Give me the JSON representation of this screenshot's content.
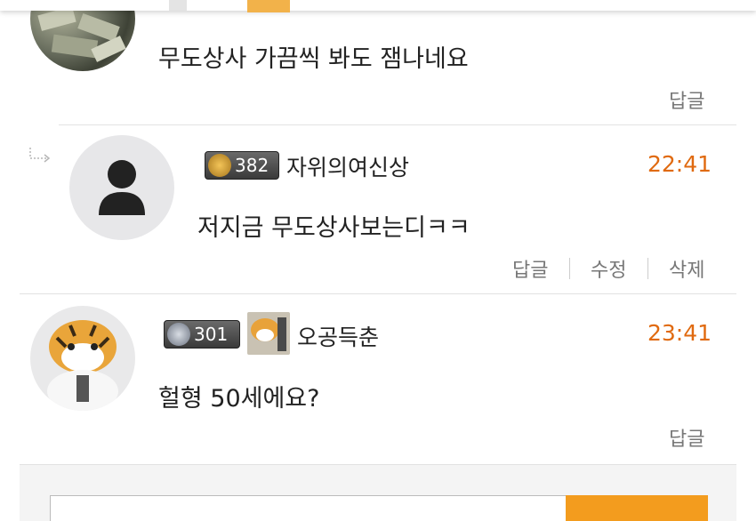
{
  "comments": [
    {
      "text": "무도상사 가끔씩 봐도 잼나네요",
      "actions": [
        "답글"
      ]
    },
    {
      "is_reply": true,
      "level": "382",
      "nickname": "자위의여신상",
      "time": "22:41",
      "text": "저지금 무도상사보는디ㅋㅋ",
      "actions": [
        "답글",
        "수정",
        "삭제"
      ]
    },
    {
      "level": "301",
      "nickname": "오공득춘",
      "time": "23:41",
      "text": "헐형 50세에요?",
      "actions": [
        "답글"
      ]
    }
  ],
  "colors": {
    "accent": "#f39c1e",
    "time": "#e06a10"
  }
}
